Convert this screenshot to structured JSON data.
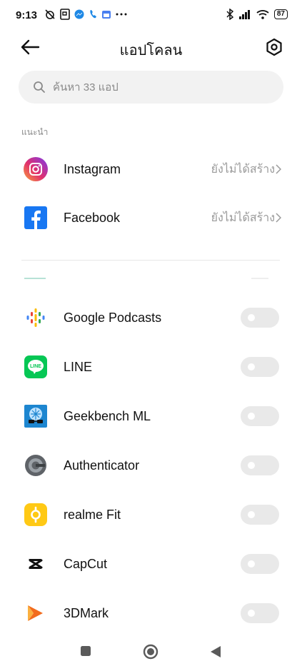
{
  "status_bar": {
    "time": "9:13",
    "battery": "87"
  },
  "header": {
    "title": "แอปโคลน"
  },
  "search": {
    "placeholder": "ค้นหา 33 แอป"
  },
  "suggested": {
    "label": "แนะนำ",
    "items": [
      {
        "name": "Instagram",
        "status": "ยังไม่ได้สร้าง"
      },
      {
        "name": "Facebook",
        "status": "ยังไม่ได้สร้าง"
      }
    ]
  },
  "apps": [
    {
      "name": "Google Podcasts",
      "enabled": false
    },
    {
      "name": "LINE",
      "enabled": false
    },
    {
      "name": "Geekbench ML",
      "enabled": false
    },
    {
      "name": "Authenticator",
      "enabled": false
    },
    {
      "name": "realme Fit",
      "enabled": false
    },
    {
      "name": "CapCut",
      "enabled": false
    },
    {
      "name": "3DMark",
      "enabled": false
    }
  ]
}
